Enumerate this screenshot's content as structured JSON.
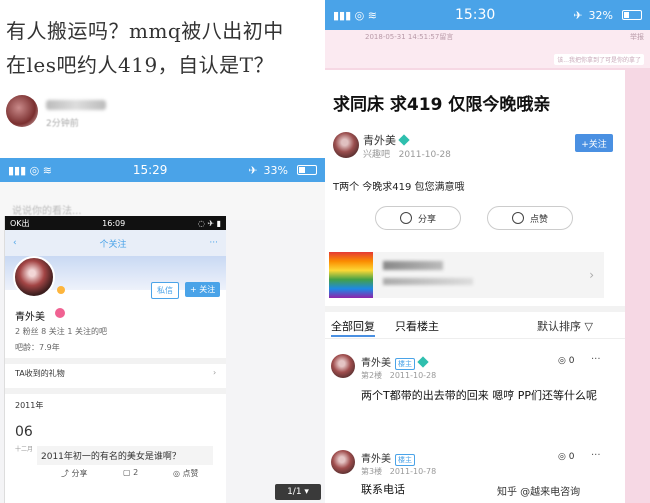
{
  "caption": {
    "line1": "有人搬运吗？mmq被八出初中",
    "line2": "在les吧约人419，自认是T？",
    "time": "2分钟前"
  },
  "left_phone": {
    "status_time": "15:29",
    "battery": "33%",
    "search_placeholder": "说说你的看法...",
    "inner": {
      "status_carrier": "OK出",
      "status_time": "16:09",
      "header_label": "个关注",
      "follow_label1": "私信",
      "follow_label2": "+ 关注",
      "username": "青外美",
      "stats": "2 粉丝   8 关注   1 关注的吧",
      "age": "吧龄：7.9年",
      "gifts_label": "TA收到的礼物",
      "year": "2011年",
      "day": "06",
      "month": "十二月",
      "post_line": "2011年初一的有名的美女是谁啊？",
      "action_share": "分享",
      "action_reply": "2",
      "action_like": "点赞"
    },
    "page_btn": "1/1 ▾"
  },
  "right_phone": {
    "status_time": "15:30",
    "battery": "32%",
    "top_label": "2018-05-31 14:51:57留言",
    "top_label_right": "举报",
    "mini_tag": "该...我把你拿到了可是你的拿了",
    "post_title": "求同床 求419 仅限今晚哦亲",
    "author": "青外美",
    "author_bar": "兴趣吧",
    "post_date": "2011-10-28",
    "follow": "+关注",
    "body": "T两个 今晚求419 包您满意哦",
    "share": "分享",
    "like": "点赞",
    "tabs": [
      "全部回复",
      "只看楼主",
      "默认排序"
    ],
    "replies": [
      {
        "name": "青外美",
        "badge": "楼主",
        "floor": "第2楼",
        "date": "2011-10-28",
        "likes": "0",
        "text": "两个T都带的出去带的回来 嗯哼 PP们还等什么呢"
      },
      {
        "name": "青外美",
        "badge": "楼主",
        "floor": "第3楼",
        "date": "2011-10-78",
        "likes": "0",
        "text": "联系电话"
      }
    ],
    "watermark": "知乎 @越来电咨询"
  }
}
